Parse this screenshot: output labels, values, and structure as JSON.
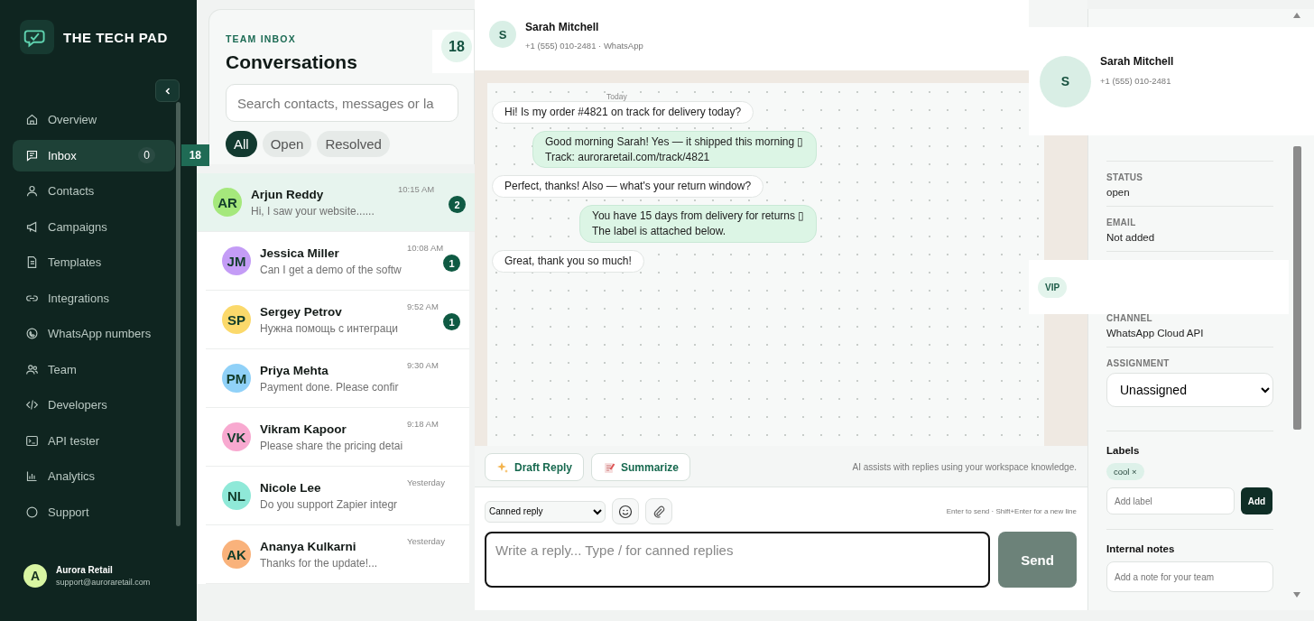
{
  "brand": {
    "name": "THE TECH PAD"
  },
  "nav": [
    {
      "label": "Overview",
      "selected": false
    },
    {
      "label": "Inbox",
      "selected": true,
      "badges": [
        "0",
        "18"
      ]
    },
    {
      "label": "Contacts",
      "selected": false
    },
    {
      "label": "Campaigns",
      "selected": false
    },
    {
      "label": "Templates",
      "selected": false
    },
    {
      "label": "Integrations",
      "selected": false
    },
    {
      "label": "WhatsApp numbers",
      "selected": false
    },
    {
      "label": "Team",
      "selected": false
    },
    {
      "label": "Developers",
      "selected": false
    },
    {
      "label": "API tester",
      "selected": false
    },
    {
      "label": "Analytics",
      "selected": false
    },
    {
      "label": "Support",
      "selected": false
    }
  ],
  "user": {
    "initial": "A",
    "name": "Aurora Retail",
    "email": "support@auroraretail.com"
  },
  "inbox": {
    "eyebrow": "TEAM INBOX",
    "title": "Conversations",
    "count": "18",
    "search_placeholder": "Search contacts, messages or la",
    "filters": [
      {
        "label": "All",
        "selected": true
      },
      {
        "label": "Open",
        "selected": false
      },
      {
        "label": "Resolved",
        "selected": false
      }
    ],
    "conversations": [
      {
        "initials": "AR",
        "name": "Arjun Reddy",
        "preview": "Hi, I saw your website......",
        "time": "10:15 AM",
        "unread": "2",
        "color": "#a5e87c",
        "selected": true
      },
      {
        "initials": "JM",
        "name": "Jessica Miller",
        "preview": "Can I get a demo of the softw",
        "time": "10:08 AM",
        "unread": "1",
        "color": "#c49cf6",
        "selected": false
      },
      {
        "initials": "SP",
        "name": "Sergey Petrov",
        "preview": "Нужна помощь с интеграци",
        "time": "9:52 AM",
        "unread": "1",
        "color": "#fbd96b",
        "selected": false
      },
      {
        "initials": "PM",
        "name": "Priya Mehta",
        "preview": "Payment done. Please confir",
        "time": "9:30 AM",
        "color": "#90d1f8",
        "selected": false
      },
      {
        "initials": "VK",
        "name": "Vikram Kapoor",
        "preview": "Please share the pricing detai",
        "time": "9:18 AM",
        "color": "#f8a9d0",
        "selected": false
      },
      {
        "initials": "NL",
        "name": "Nicole Lee",
        "preview": "Do you support Zapier integr",
        "time": "Yesterday",
        "color": "#8fe9d8",
        "selected": false
      },
      {
        "initials": "AK",
        "name": "Ananya Kulkarni",
        "preview": "Thanks for the update!...",
        "time": "Yesterday",
        "color": "#f9b27b",
        "selected": false
      }
    ]
  },
  "chat": {
    "contact": {
      "initial": "S",
      "name": "Sarah Mitchell",
      "subtitle": "+1 (555) 010-2481 · WhatsApp"
    },
    "date": "Today",
    "messages": [
      {
        "kind": "incoming",
        "lines": [
          "Hi! Is my order #4821 on track for delivery today?"
        ]
      },
      {
        "kind": "outgoing",
        "lines": [
          "Good morning Sarah! Yes — it shipped this morning ▯",
          "Track: auroraretail.com/track/4821"
        ]
      },
      {
        "kind": "incoming",
        "lines": [
          "Perfect, thanks! Also — what's your return window?"
        ]
      },
      {
        "kind": "outgoing",
        "lines": [
          "You have 15 days from delivery for returns ▯",
          "The label is attached below."
        ]
      },
      {
        "kind": "incoming",
        "lines": [
          "Great, thank you so much!"
        ]
      }
    ],
    "ai_actions": [
      {
        "label": "Draft Reply"
      },
      {
        "label": "Summarize"
      }
    ],
    "ai_note": "AI assists with replies using your workspace knowledge.",
    "canned": {
      "value": "Canned reply"
    },
    "hint": "Enter to send · Shift+Enter for a new line",
    "reply_placeholder": "Write a reply... Type / for canned replies",
    "send": "Send"
  },
  "details": {
    "card": {
      "initial": "S",
      "name": "Sarah Mitchell",
      "phone": "+1 (555) 010-2481"
    },
    "fields": [
      {
        "label": "STATUS",
        "value": "open"
      },
      {
        "label": "EMAIL",
        "value": "Not added"
      }
    ],
    "tag": "VIP",
    "channel": {
      "label": "CHANNEL",
      "value": "WhatsApp Cloud API"
    },
    "assignment": {
      "label": "ASSIGNMENT",
      "value": "Unassigned"
    },
    "labels": {
      "title": "Labels",
      "chips": [
        {
          "text": "cool",
          "remove": "×"
        }
      ],
      "placeholder": "Add label",
      "button": "Add"
    },
    "notes": {
      "title": "Internal notes",
      "placeholder": "Add a note for your team"
    }
  }
}
